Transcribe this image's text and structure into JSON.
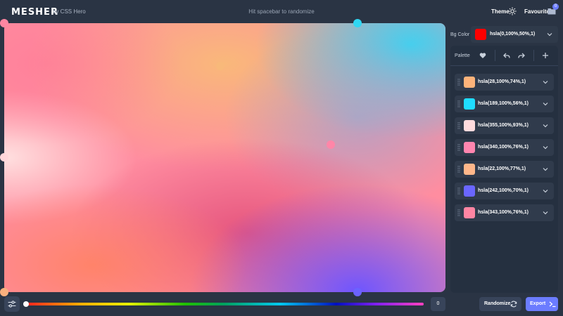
{
  "header": {
    "logo": "MESHER",
    "byline": "by CSS Hero",
    "hint": "Hit spacebar to randomize",
    "theme_label": "Theme",
    "favourites_label": "Favourites",
    "favourites_count": "0"
  },
  "canvas": {
    "handles": [
      {
        "name": "handle-top-left",
        "color": "#ff86a2"
      },
      {
        "name": "handle-top-mid",
        "color": "#2fd6f2"
      },
      {
        "name": "handle-center-top",
        "color": "#f8b97a"
      },
      {
        "name": "handle-left-mid",
        "color": "#ffd6da"
      },
      {
        "name": "handle-center-right",
        "color": "#ff86a8"
      },
      {
        "name": "handle-bottom-left",
        "color": "#f9b07e"
      },
      {
        "name": "handle-bottom-mid",
        "color": "#6b62ff"
      }
    ]
  },
  "sidebar": {
    "bg_label": "Bg Color",
    "bg_color": {
      "swatch": "#ff0000",
      "value": "hsla(0,100%,50%,1)"
    },
    "palette_label": "Palette",
    "colors": [
      {
        "swatch": "#fdb37a",
        "value": "hsla(28,100%,74%,1)"
      },
      {
        "swatch": "#1fdcff",
        "value": "hsla(189,100%,56%,1)"
      },
      {
        "swatch": "#ffdbde",
        "value": "hsla(355,100%,93%,1)"
      },
      {
        "swatch": "#ff85af",
        "value": "hsla(340,100%,76%,1)"
      },
      {
        "swatch": "#ffb78a",
        "value": "hsla(22,100%,77%,1)"
      },
      {
        "swatch": "#6a66ff",
        "value": "hsla(242,100%,70%,1)"
      },
      {
        "swatch": "#ff85a3",
        "value": "hsla(343,100%,76%,1)"
      }
    ]
  },
  "footer": {
    "slider_value": "0",
    "randomize_label": "Randomize",
    "export_label": "Export"
  },
  "colors": {
    "accent": "#6b7cff",
    "background": "#2a3444"
  }
}
